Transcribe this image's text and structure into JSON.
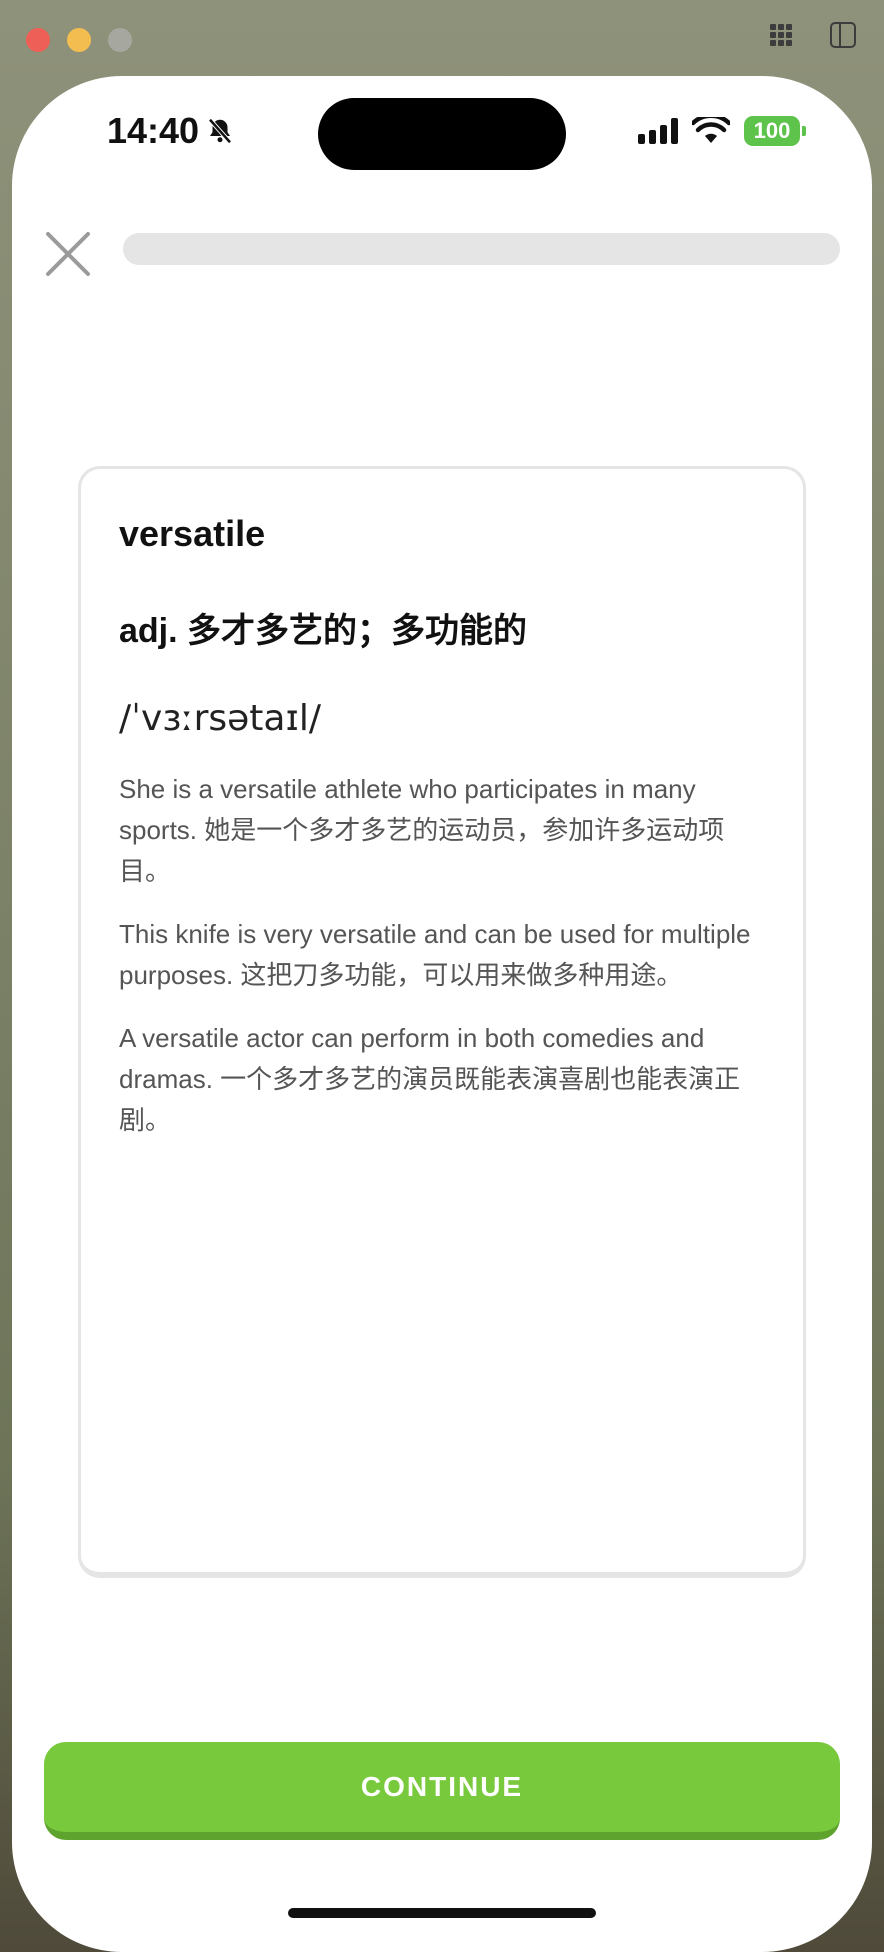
{
  "status_bar": {
    "time": "14:40",
    "battery": "100"
  },
  "lesson": {
    "progress_percent": 0
  },
  "card": {
    "word": "versatile",
    "part_of_speech": "adj. 多才多艺的；多功能的",
    "phonetic": "/ˈvɜːrsətaɪl/",
    "examples": [
      "She is a versatile athlete who participates in many sports. 她是一个多才多艺的运动员，参加许多运动项目。",
      "This knife is very versatile and can be used for multiple purposes. 这把刀多功能，可以用来做多种用途。",
      "A versatile actor can perform in both comedies and dramas. 一个多才多艺的演员既能表演喜剧也能表演正剧。"
    ]
  },
  "footer": {
    "continue_label": "CONTINUE"
  },
  "colors": {
    "accent_green": "#78c93c",
    "accent_green_shadow": "#5ea32e",
    "battery_green": "#5ec34b"
  }
}
